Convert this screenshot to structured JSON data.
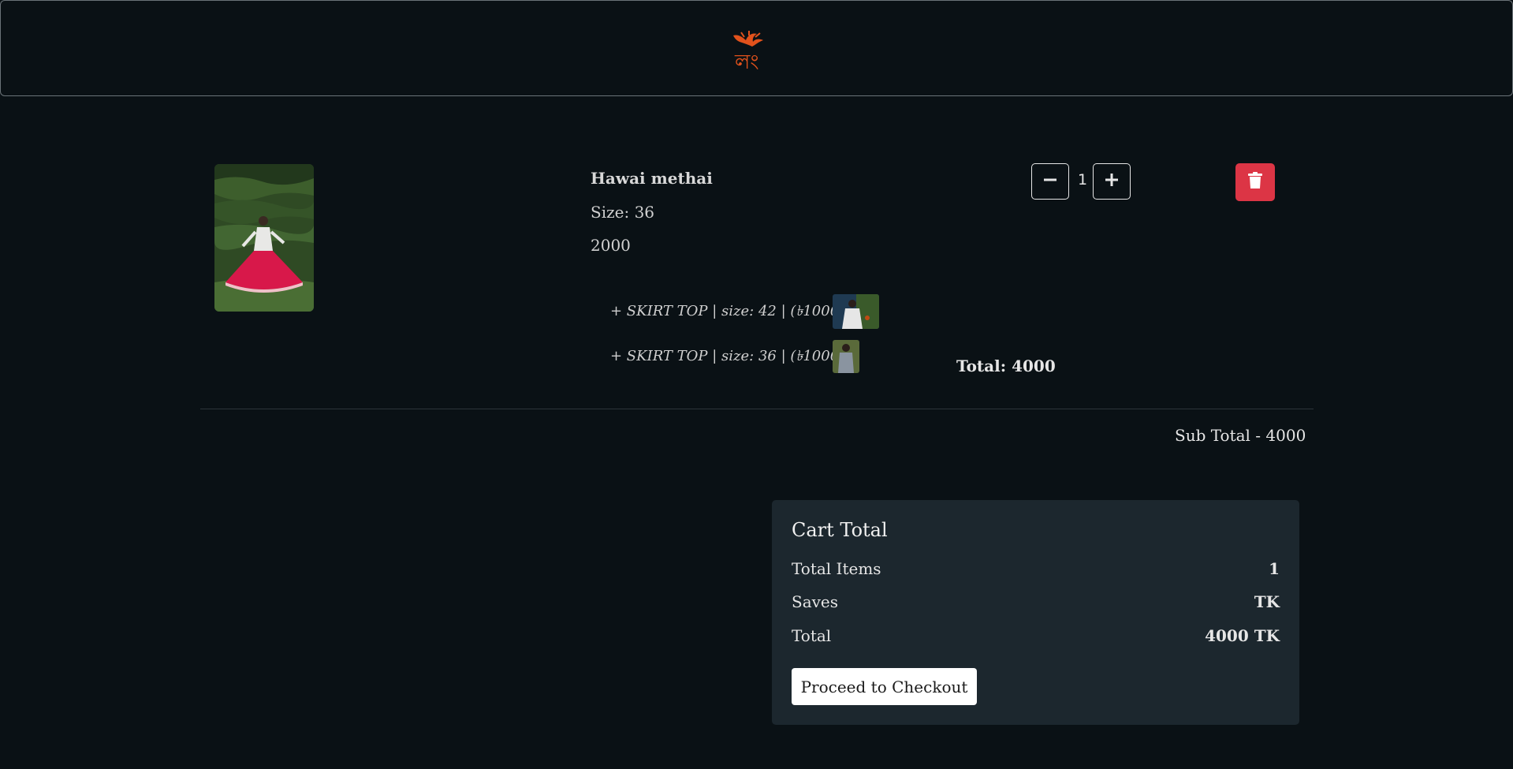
{
  "header": {
    "logo_text": "লং"
  },
  "item": {
    "name": "Hawai methai",
    "size": "Size: 36",
    "price": "2000",
    "quantity": "1",
    "addons": [
      "+ SKIRT TOP | size: 42 | (৳1000)",
      "+ SKIRT TOP | size: 36 | (৳1000)"
    ],
    "total": "Total: 4000"
  },
  "subtotal": "Sub Total - 4000",
  "cart_total": {
    "title": "Cart Total",
    "rows": [
      {
        "label": "Total Items",
        "value": "1"
      },
      {
        "label": "Saves",
        "value": "TK"
      },
      {
        "label": "Total",
        "value": "4000 TK"
      }
    ],
    "checkout_label": "Proceed to Checkout"
  },
  "colors": {
    "background": "#0a1115",
    "logo": "#e2521c",
    "delete_button": "#dc3545",
    "cart_panel": "#1c272e"
  },
  "icons": [
    "minus-icon",
    "plus-icon",
    "trash-icon"
  ]
}
